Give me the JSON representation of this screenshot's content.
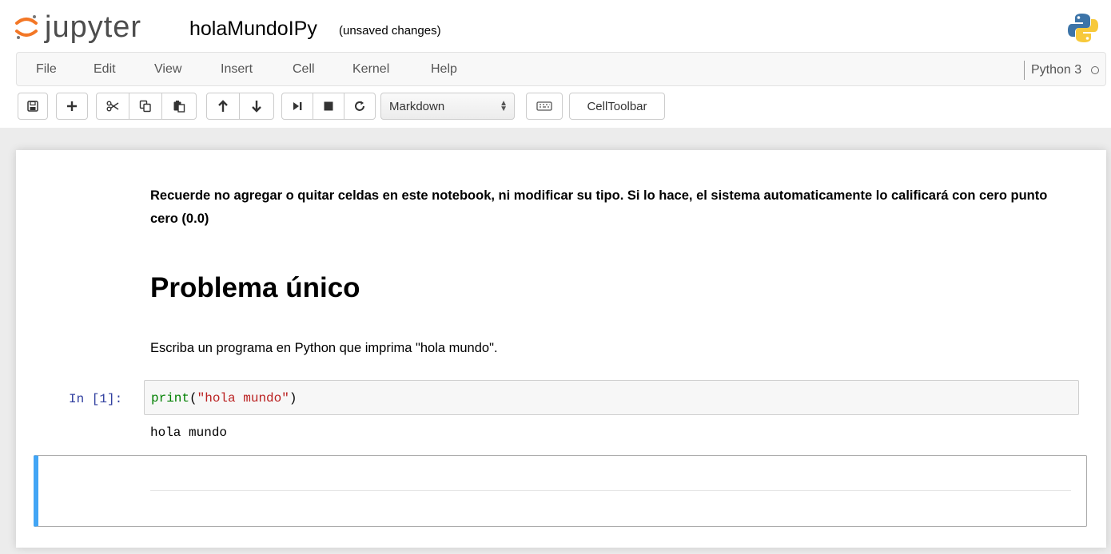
{
  "header": {
    "logo_text": "jupyter",
    "notebook_name": "holaMundoIPy",
    "save_status": "(unsaved changes)"
  },
  "menu": {
    "items": [
      "File",
      "Edit",
      "View",
      "Insert",
      "Cell",
      "Kernel",
      "Help"
    ],
    "kernel_name": "Python 3"
  },
  "toolbar": {
    "buttons": [
      {
        "name": "save",
        "icon": "floppy-disk-icon"
      },
      {
        "name": "insert-cell-below",
        "icon": "plus-icon"
      },
      {
        "name": "cut",
        "icon": "scissors-icon"
      },
      {
        "name": "copy",
        "icon": "copy-icon"
      },
      {
        "name": "paste",
        "icon": "paste-icon"
      },
      {
        "name": "move-up",
        "icon": "arrow-up-icon"
      },
      {
        "name": "move-down",
        "icon": "arrow-down-icon"
      },
      {
        "name": "run",
        "icon": "step-forward-icon"
      },
      {
        "name": "interrupt",
        "icon": "stop-icon"
      },
      {
        "name": "restart",
        "icon": "refresh-icon"
      },
      {
        "name": "command-palette",
        "icon": "keyboard-icon"
      }
    ],
    "cell_type": "Markdown",
    "celltoolbar_label": "CellToolbar"
  },
  "notebook": {
    "instructions": "Recuerde no agregar o quitar celdas en este notebook, ni modificar su tipo. Si lo hace, el sistema automaticamente lo calificará con cero punto cero (0.0)",
    "heading": "Problema único",
    "prompt_text": "Escriba un programa en Python que imprima \"hola mundo\".",
    "code_cell": {
      "prompt": "In [1]:",
      "code_builtin": "print",
      "code_open": "(",
      "code_string": "\"hola mundo\"",
      "code_close": ")",
      "output": "hola mundo"
    }
  },
  "colors": {
    "selected_cell_accent": "#42a5f5",
    "prompt_color": "#303f9f",
    "builtin_color": "#008000",
    "string_color": "#ba2121",
    "logo_orange": "#f37726"
  }
}
